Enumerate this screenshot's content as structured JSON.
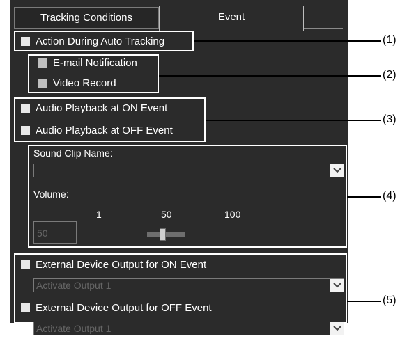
{
  "tabs": [
    {
      "label": "Tracking Conditions",
      "active": false
    },
    {
      "label": "Event",
      "active": true
    }
  ],
  "action_auto": {
    "label": "Action During Auto Tracking",
    "checked": false
  },
  "email": {
    "label": "E-mail Notification",
    "checked": false
  },
  "video": {
    "label": "Video Record",
    "checked": false
  },
  "audio_on": {
    "label": "Audio Playback at ON Event",
    "checked": false
  },
  "audio_off": {
    "label": "Audio Playback at OFF Event",
    "checked": false
  },
  "sound_clip": {
    "label": "Sound Clip Name:",
    "value": ""
  },
  "volume": {
    "label": "Volume:",
    "value": "50",
    "min_label": "1",
    "mid_label": "50",
    "max_label": "100"
  },
  "ext_on": {
    "label": "External Device Output for ON Event",
    "checked": false,
    "select": "Activate Output 1"
  },
  "ext_off": {
    "label": "External Device Output for OFF Event",
    "checked": false,
    "select": "Activate Output 1"
  },
  "callouts": [
    "(1)",
    "(2)",
    "(3)",
    "(4)",
    "(5)"
  ],
  "icons": {
    "dropdown": "chevron-down-icon",
    "checkbox": "checkbox-icon"
  },
  "colors": {
    "panel": "#2b2b2b",
    "text": "#ffffff",
    "highlight_box": "#ffffff"
  }
}
